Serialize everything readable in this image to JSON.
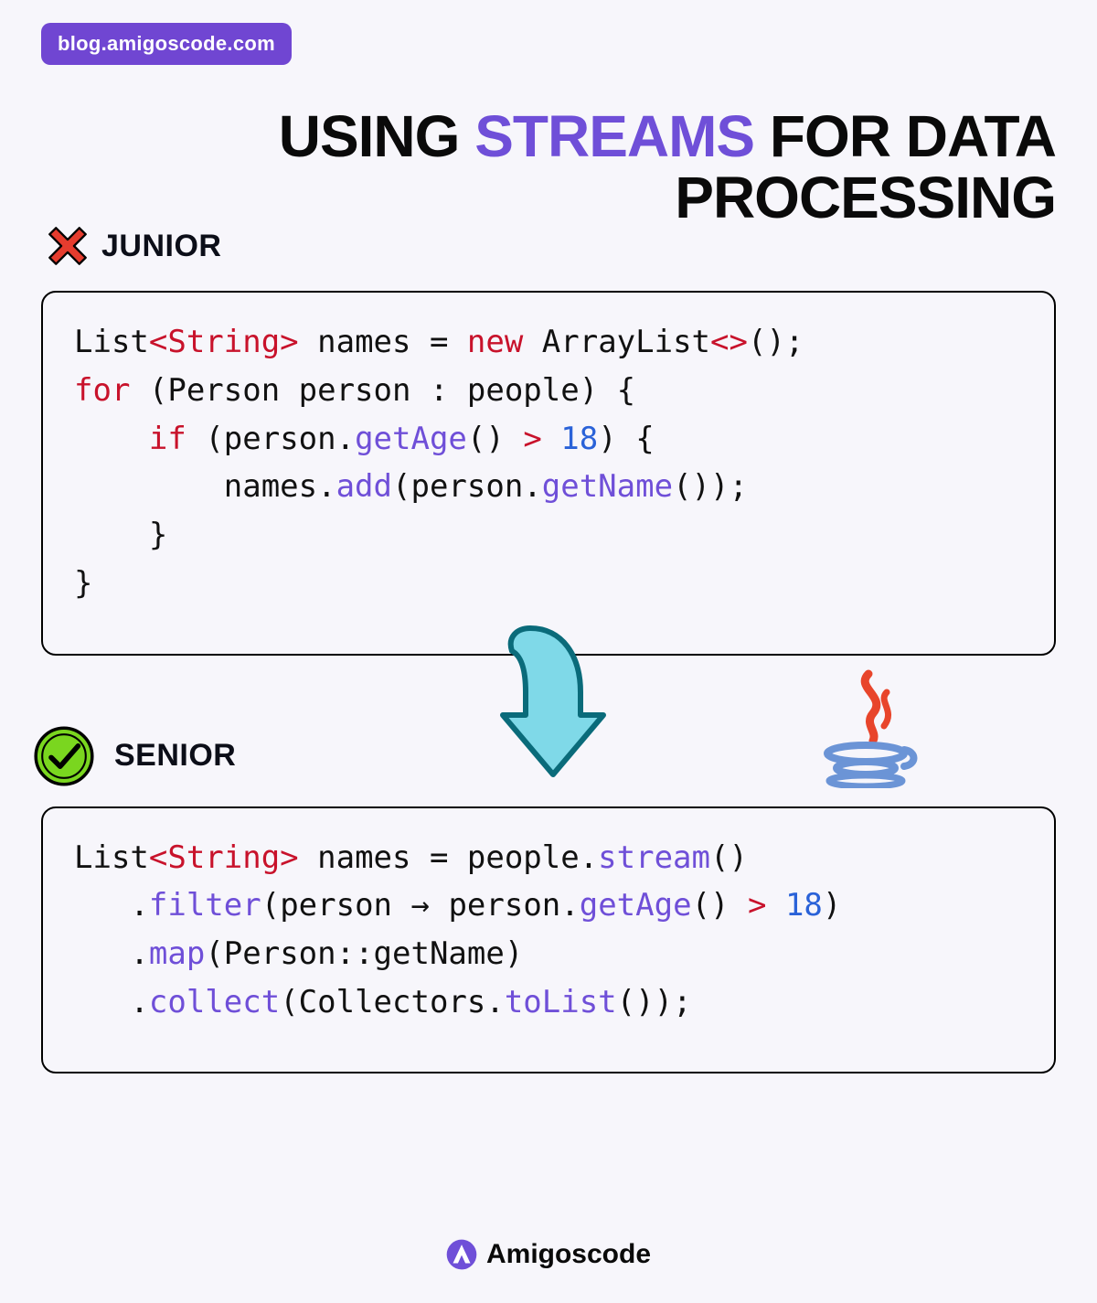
{
  "badge": "blog.amigoscode.com",
  "title_parts": {
    "p1": "USING ",
    "accent": "STREAMS",
    "p2": " FOR DATA",
    "p3": "PROCESSING"
  },
  "junior_label": "JUNIOR",
  "senior_label": "SENIOR",
  "junior_code": {
    "l1a": "List",
    "l1b": "<String>",
    "l1c": " names = ",
    "l1d": "new",
    "l1e": " ArrayList",
    "l1f": "<>",
    "l1g": "();",
    "l2a": "for",
    "l2b": " (Person person : people) {",
    "l3a": "    ",
    "l3b": "if",
    "l3c": " (person.",
    "l3d": "getAge",
    "l3e": "() ",
    "l3f": ">",
    "l3g": " ",
    "l3h": "18",
    "l3i": ") {",
    "l4a": "        names.",
    "l4b": "add",
    "l4c": "(person.",
    "l4d": "getName",
    "l4e": "());",
    "l5": "    }",
    "l6": "}"
  },
  "senior_code": {
    "l1a": "List",
    "l1b": "<String>",
    "l1c": " names = people.",
    "l1d": "stream",
    "l1e": "()",
    "l2a": "   .",
    "l2b": "filter",
    "l2c": "(person ",
    "l2d": "→",
    "l2e": " person.",
    "l2f": "getAge",
    "l2g": "() ",
    "l2h": ">",
    "l2i": " ",
    "l2j": "18",
    "l2k": ")",
    "l3a": "   .",
    "l3b": "map",
    "l3c": "(Person::getName)",
    "l4a": "   .",
    "l4b": "collect",
    "l4c": "(Collectors.",
    "l4d": "toList",
    "l4e": "());"
  },
  "footer_text": "Amigoscode",
  "colors": {
    "accent_purple": "#6f4fd8",
    "badge_purple": "#7046d2",
    "keyword_red": "#c8122b",
    "number_blue": "#2a62d8",
    "arrow_teal": "#6fd4e4"
  }
}
